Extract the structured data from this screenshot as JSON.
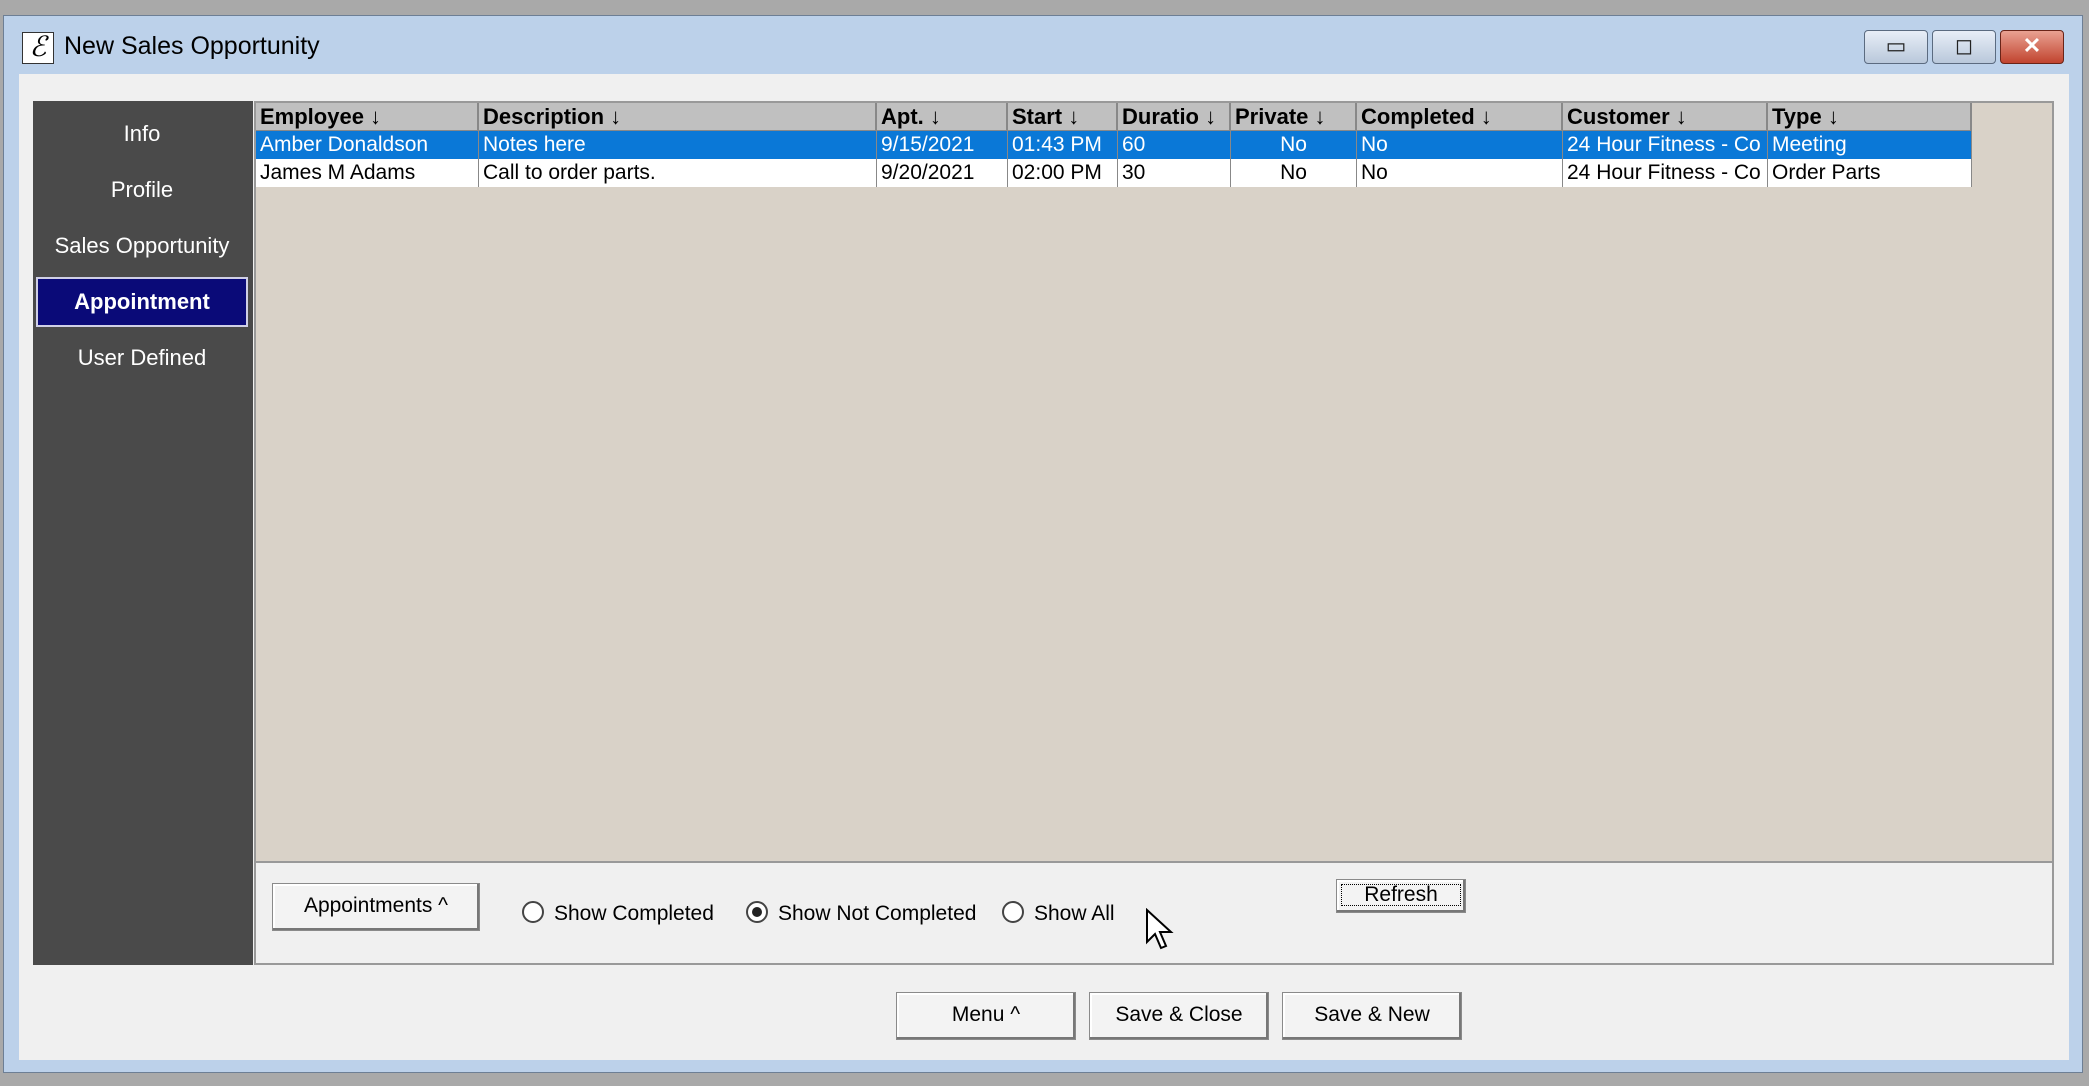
{
  "window": {
    "title": "New Sales Opportunity",
    "app_icon": "ℰ",
    "minimize_glyph": "▭",
    "maximize_glyph": "◻",
    "close_glyph": "✕"
  },
  "sidebar": {
    "items": [
      {
        "label": "Info"
      },
      {
        "label": "Profile"
      },
      {
        "label": "Sales Opportunity"
      },
      {
        "label": "Appointment"
      },
      {
        "label": "User Defined"
      }
    ],
    "active_index": 3
  },
  "grid": {
    "columns": [
      "Employee ↓",
      "Description ↓",
      "Apt. ↓",
      "Start ↓",
      "Duratio ↓",
      "Private ↓",
      "Completed ↓",
      "Customer ↓",
      "Type ↓"
    ],
    "rows": [
      [
        "Amber Donaldson",
        "Notes here",
        "9/15/2021",
        "01:43 PM",
        "60",
        "No",
        "No",
        "24 Hour Fitness - Co",
        "Meeting"
      ],
      [
        "James M Adams",
        "Call to order parts.",
        "9/20/2021",
        "02:00 PM",
        "30",
        "No",
        "No",
        "24 Hour Fitness - Co",
        "Order Parts"
      ]
    ],
    "selected_row": 0
  },
  "filters": {
    "appointments_button": "Appointments ^",
    "options": [
      {
        "label": "Show Completed",
        "selected": false
      },
      {
        "label": "Show Not Completed",
        "selected": true
      },
      {
        "label": "Show All",
        "selected": false
      }
    ],
    "refresh": "Refresh"
  },
  "footer": {
    "menu": "Menu ^",
    "save_close": "Save & Close",
    "save_new": "Save & New"
  },
  "colors": {
    "selection": "#0a78d7",
    "sidebar_bg": "#4a4a4a",
    "sidebar_active": "#0a0a78",
    "grid_bg": "#d9d2c8"
  }
}
